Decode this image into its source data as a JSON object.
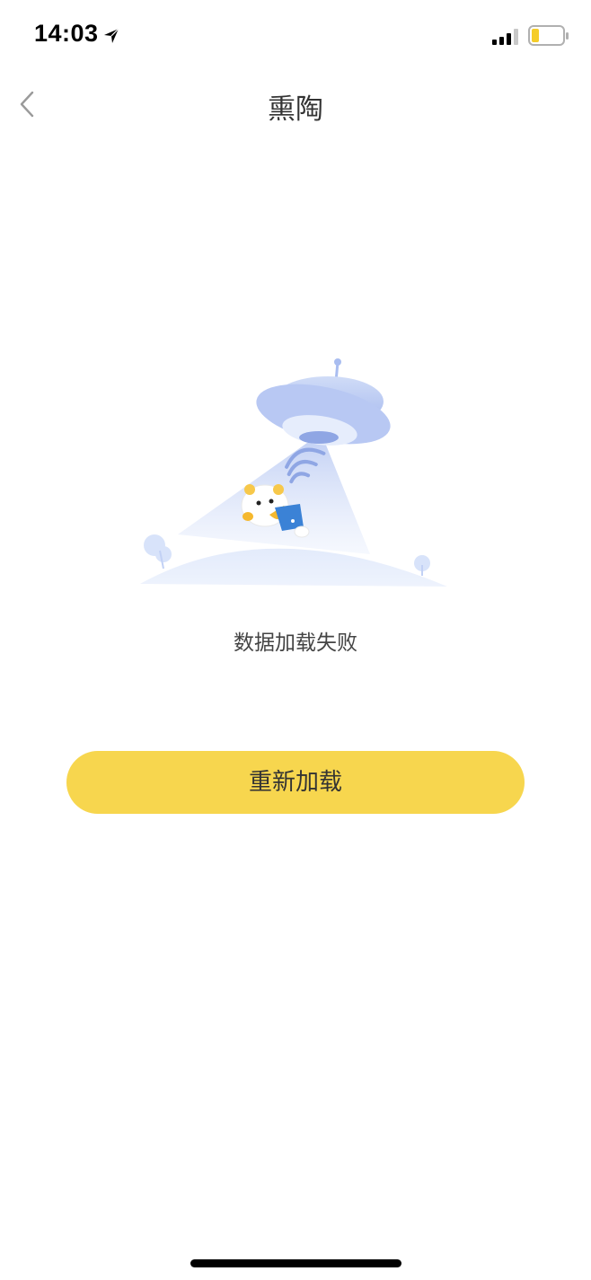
{
  "status_bar": {
    "time": "14:03",
    "icons": [
      "location-arrow-icon",
      "signal-icon",
      "battery-icon"
    ],
    "battery_color": "#f5cd2a"
  },
  "nav": {
    "title": "熏陶",
    "back_icon": "chevron-left-icon"
  },
  "content": {
    "illustration": "ufo-mascot-illustration",
    "message": "数据加载失败",
    "reload_label": "重新加载"
  },
  "colors": {
    "accent": "#f7d64e",
    "text": "#333333",
    "illustration_blue": "#a9bdf0"
  }
}
